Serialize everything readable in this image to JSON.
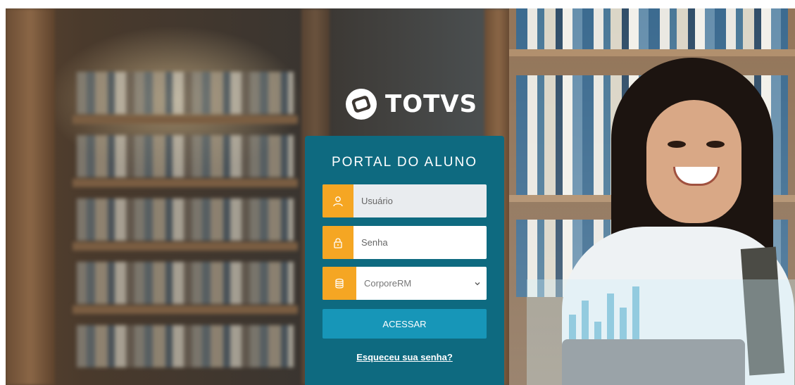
{
  "brand": {
    "name": "TOTVS"
  },
  "login": {
    "title": "PORTAL DO ALUNO",
    "username_placeholder": "Usuário",
    "password_placeholder": "Senha",
    "database_selected": "CorporeRM",
    "submit_label": "ACESSAR",
    "forgot_link": "Esqueceu sua senha?"
  },
  "icons": {
    "username": "user-icon",
    "password": "lock-icon",
    "database": "database-icon",
    "dropdown": "chevron-down-icon",
    "logo": "totvs-logo-icon"
  },
  "colors": {
    "card_bg": "#0e6a80",
    "icon_bg": "#f5a623",
    "button_bg": "#1796b8",
    "text_light": "#ffffff"
  }
}
